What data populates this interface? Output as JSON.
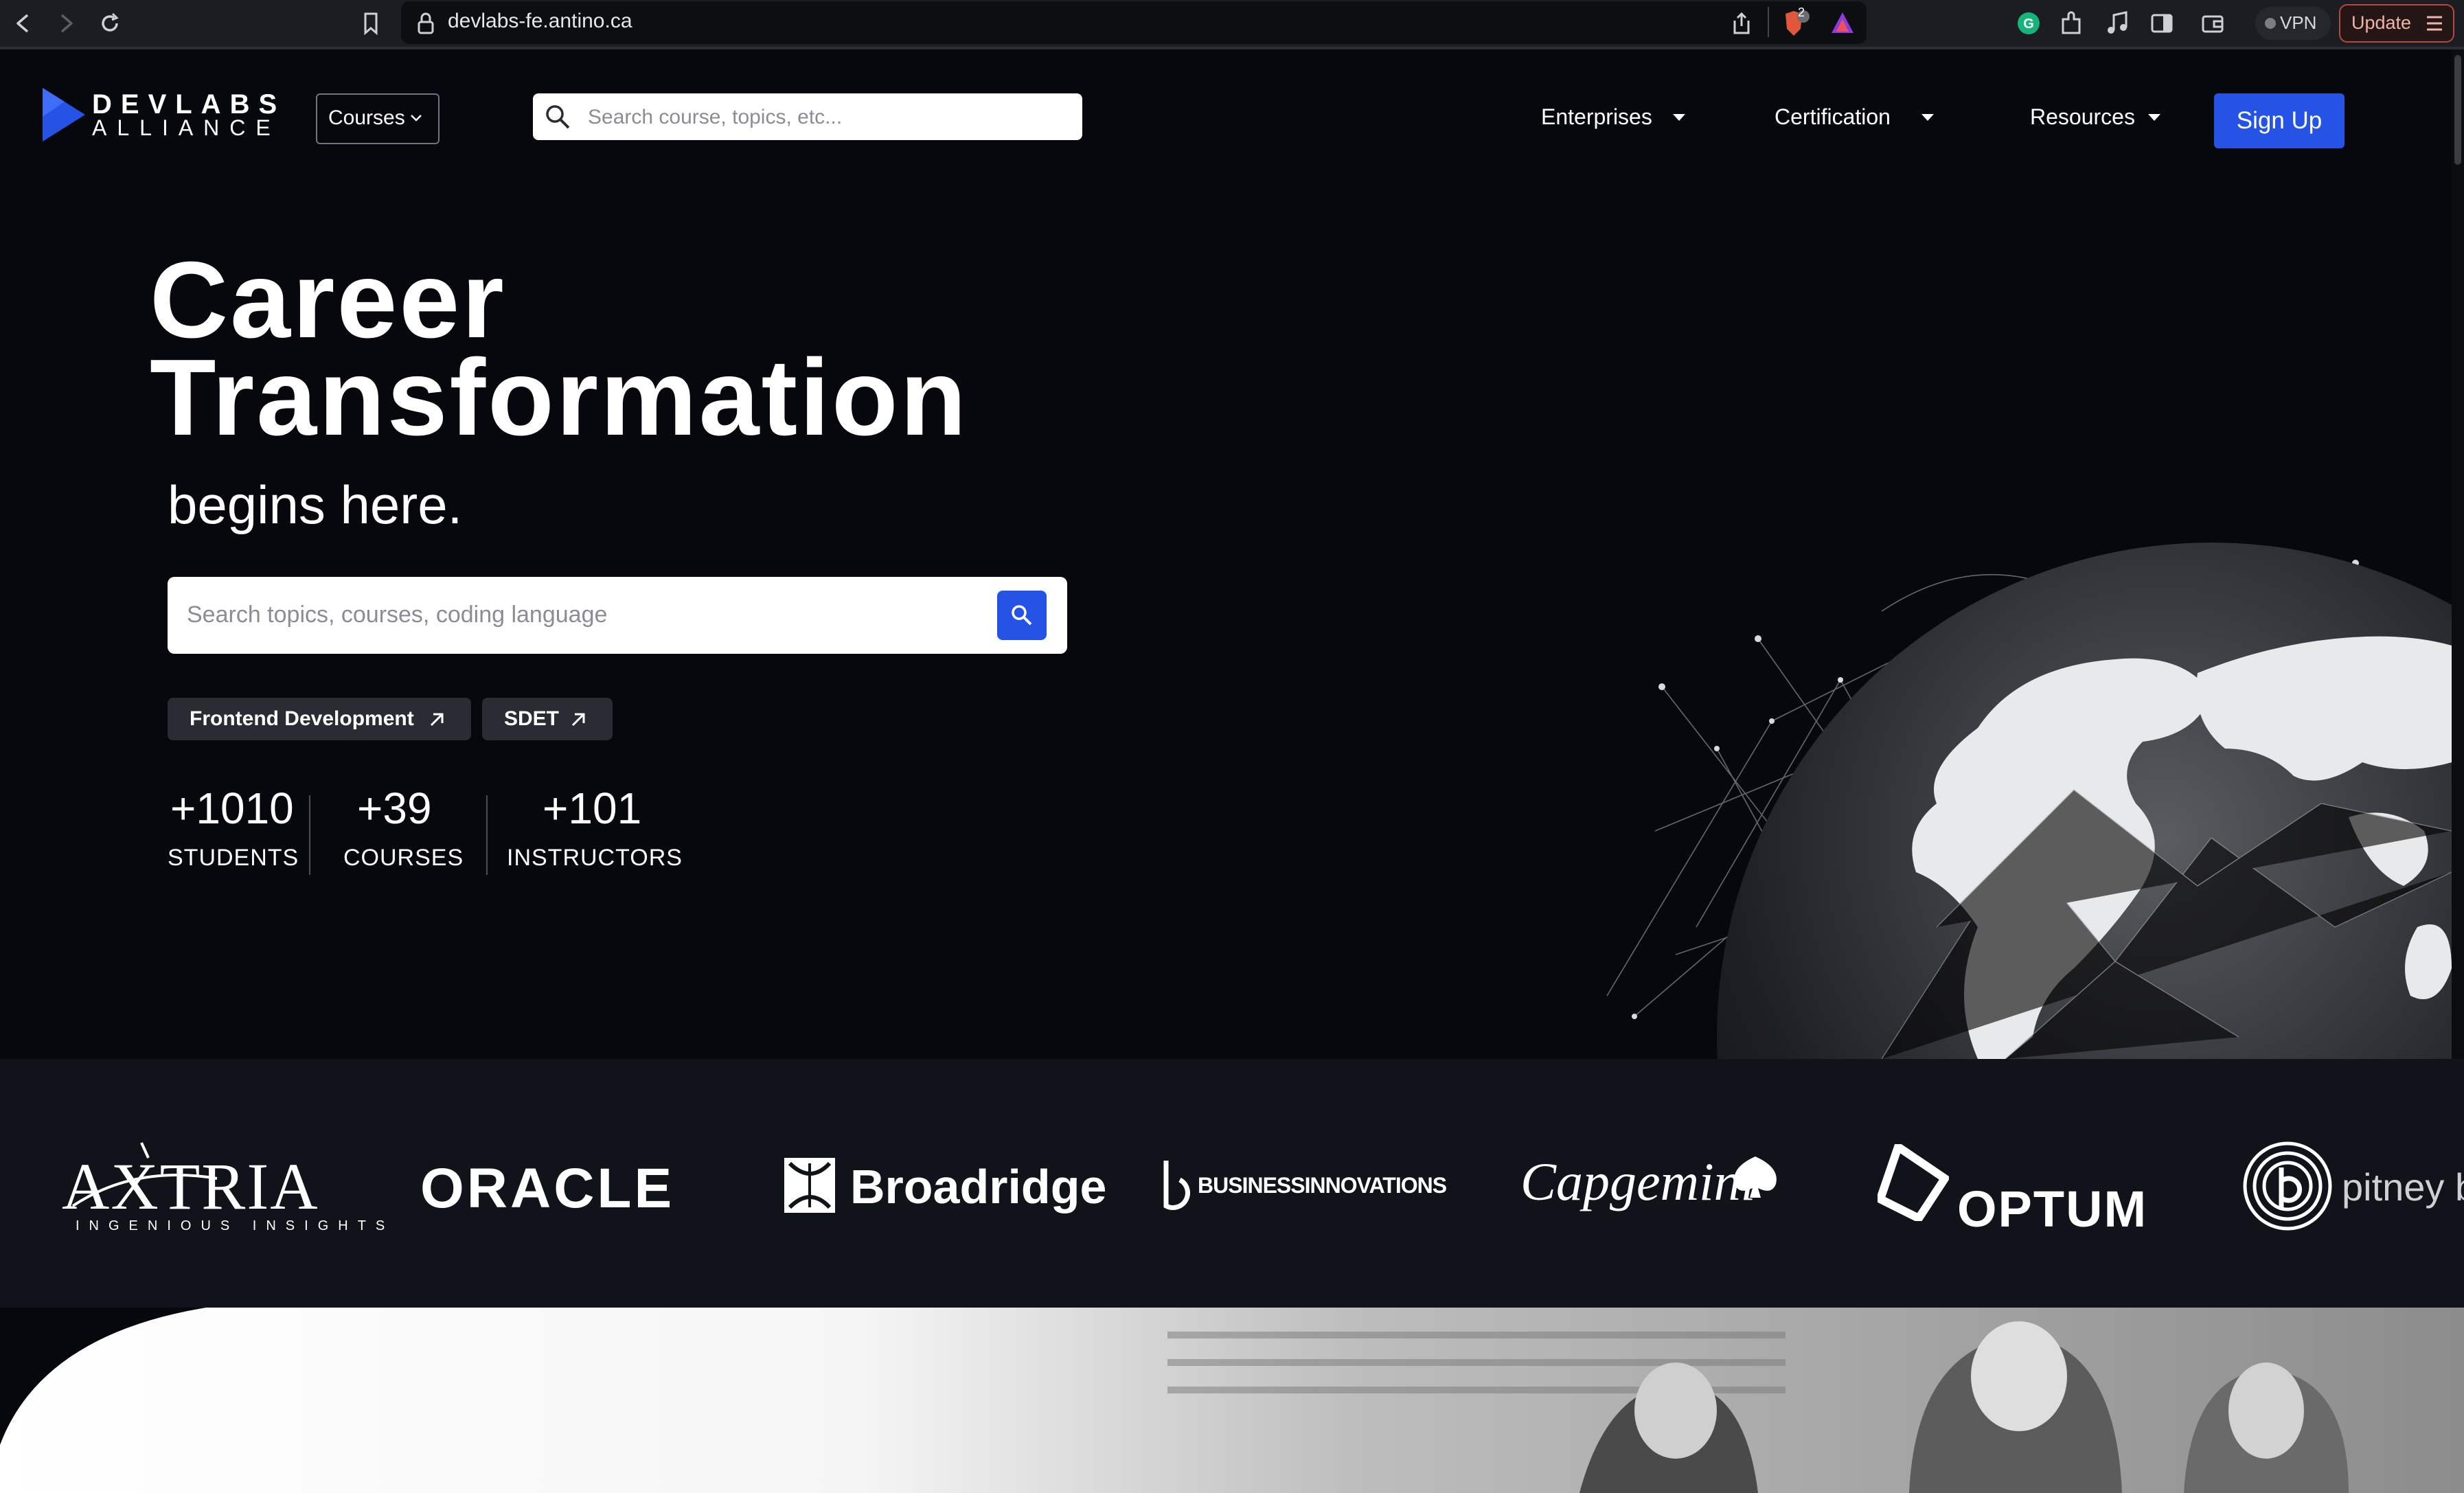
{
  "browser": {
    "url": "devlabs-fe.antino.ca",
    "brave_badge": "2",
    "vpn_label": "VPN",
    "update_label": "Update"
  },
  "header": {
    "logo_line1": "DEVLABS",
    "logo_line2": "ALLIANCE",
    "courses_label": "Courses",
    "search_placeholder": "Search course, topics, etc...",
    "nav": [
      {
        "label": "Enterprises"
      },
      {
        "label": "Certification"
      },
      {
        "label": "Resources"
      }
    ],
    "signup_label": "Sign Up"
  },
  "hero": {
    "title_line1": "Career",
    "title_line2": "Transformation",
    "subtitle": "begins here.",
    "search_placeholder": "Search topics, courses, coding language",
    "tags": [
      {
        "label": "Frontend Development"
      },
      {
        "label": "SDET"
      }
    ],
    "stats": [
      {
        "value": "+1010",
        "label": "STUDENTS"
      },
      {
        "value": "+39",
        "label": "COURSES"
      },
      {
        "value": "+101",
        "label": "INSTRUCTORS"
      }
    ]
  },
  "partners": {
    "axtria": "AXTRIA",
    "axtria_tagline": "INGENIOUS INSIGHTS",
    "oracle": "ORACLE",
    "broadridge": "Broadridge",
    "business_innovations": "BUSINESSINNOVATIONS",
    "capgemini": "Capgemini",
    "optum": "OPTUM",
    "pitney": "pitney bo"
  },
  "colors": {
    "accent": "#2553e6",
    "background": "#07080d",
    "strip": "#11131a"
  }
}
